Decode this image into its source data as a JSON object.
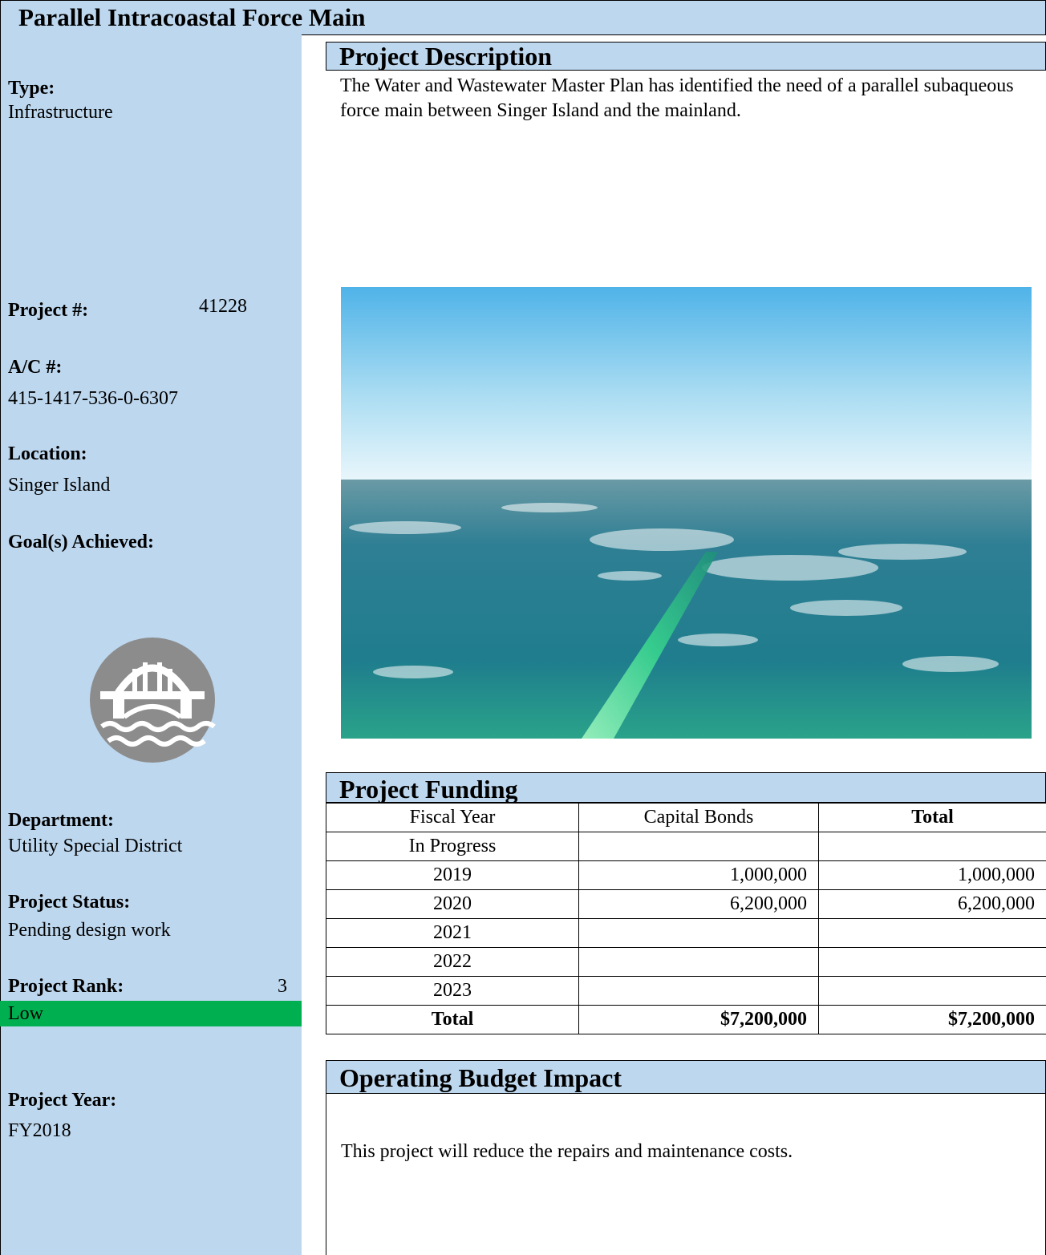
{
  "title": "Parallel Intracoastal Force Main",
  "sidebar": {
    "type_label": "Type:",
    "type_value": "Infrastructure",
    "project_no_label": "Project #:",
    "project_no_value": "41228",
    "ac_label": "A/C #:",
    "ac_value": "415-1417-536-0-6307",
    "location_label": "Location:",
    "location_value": "Singer Island",
    "goals_label": "Goal(s) Achieved:",
    "goal_icon": "bridge-over-water-icon",
    "department_label": "Department:",
    "department_value": "Utility Special District",
    "status_label": "Project Status:",
    "status_value": "Pending design work",
    "rank_label": "Project Rank:",
    "rank_value": "3",
    "rank_level": "Low",
    "rank_color": "#00b050",
    "year_label": "Project Year:",
    "year_value": "FY2018"
  },
  "description": {
    "heading": "Project Description",
    "text": "The Water and Wastewater Master Plan has identified the need of a parallel subaqueous force main between Singer Island and the mainland."
  },
  "funding": {
    "heading": "Project Funding",
    "columns": [
      "Fiscal Year",
      "Capital Bonds",
      "Total"
    ],
    "rows": [
      [
        "In Progress",
        "",
        ""
      ],
      [
        "2019",
        "1,000,000",
        "1,000,000"
      ],
      [
        "2020",
        "6,200,000",
        "6,200,000"
      ],
      [
        "2021",
        "",
        ""
      ],
      [
        "2022",
        "",
        ""
      ],
      [
        "2023",
        "",
        ""
      ]
    ],
    "total_row": [
      "Total",
      "$7,200,000",
      "$7,200,000"
    ]
  },
  "budget": {
    "heading": "Operating Budget Impact",
    "text": "This project will reduce the repairs and maintenance costs."
  },
  "colors": {
    "header_blue": "#bdd7ee",
    "rank_low_green": "#00b050"
  }
}
